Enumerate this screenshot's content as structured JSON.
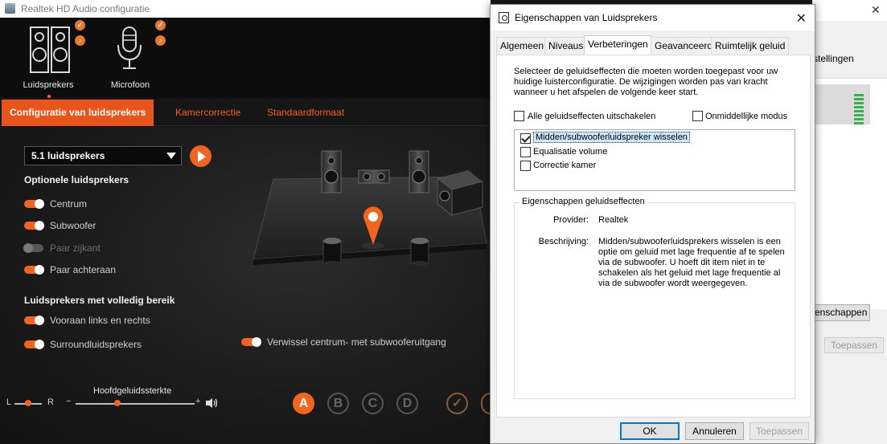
{
  "realtek": {
    "title": "Realtek HD Audio configuratie",
    "devices": [
      {
        "label": "Luidsprekers",
        "icon": "speakers-icon"
      },
      {
        "label": "Microfoon",
        "icon": "microphone-icon"
      }
    ],
    "tabs": [
      {
        "label": "Configuratie van luidsprekers",
        "active": true
      },
      {
        "label": "Kamercorrectie",
        "active": false
      },
      {
        "label": "Standaardformaat",
        "active": false
      }
    ],
    "config_select": "5.1 luidsprekers",
    "optional_heading": "Optionele luidsprekers",
    "optional": [
      {
        "label": "Centrum",
        "on": true,
        "enabled": true
      },
      {
        "label": "Subwoofer",
        "on": true,
        "enabled": true
      },
      {
        "label": "Paar zijkant",
        "on": false,
        "enabled": false
      },
      {
        "label": "Paar achteraan",
        "on": true,
        "enabled": true
      }
    ],
    "fullrange_heading": "Luidsprekers met volledig bereik",
    "fullrange": [
      {
        "label": "Vooraan links en rechts",
        "on": true
      },
      {
        "label": "Surroundluidsprekers",
        "on": true
      }
    ],
    "swap_label": "Verwissel centrum- met subwooferuitgang",
    "volume": {
      "label": "Hoofdgeluidssterkte",
      "balance_left": "L",
      "balance_right": "R",
      "minus": "−",
      "plus": "+",
      "level": 0.35,
      "balance": 0.5
    },
    "profiles": [
      "A",
      "B",
      "C",
      "D"
    ],
    "accent": "#f2651e"
  },
  "background_window": {
    "settings_fragment": "stellingen",
    "properties_fragment": "enschappen",
    "apply_label": "Toepassen"
  },
  "dialog": {
    "title": "Eigenschappen van Luidsprekers",
    "tabs": [
      "Algemeen",
      "Niveaus",
      "Verbeteringen",
      "Geavanceerd",
      "Ruimtelijk geluid"
    ],
    "active_tab": "Verbeteringen",
    "description": "Selecteer de geluidseffecten die moeten worden toegepast voor uw huidige luisterconfiguratie. De wijzigingen worden pas van kracht wanneer u het afspelen de volgende keer start.",
    "disable_all": {
      "label": "Alle geluidseffecten uitschakelen",
      "checked": false
    },
    "immediate": {
      "label": "Onmiddellijke modus",
      "checked": false
    },
    "effects": [
      {
        "label": "Midden/subwooferluidspreker wisselen",
        "checked": true,
        "selected": true
      },
      {
        "label": "Equalisatie volume",
        "checked": false
      },
      {
        "label": "Correctie kamer",
        "checked": false
      }
    ],
    "props_group": "Eigenschappen geluidseffecten",
    "provider_key": "Provider:",
    "provider_val": "Realtek",
    "desc_key": "Beschrijving:",
    "desc_val": "Midden/subwooferluidsprekers wisselen is een optie om geluid met lage frequentie af te spelen via de subwoofer. U hoeft dit item niet in te schakelen als het geluid met lage frequentie al via de subwoofer wordt weergegeven.",
    "buttons": {
      "ok": "OK",
      "cancel": "Annuleren",
      "apply": "Toepassen"
    }
  }
}
